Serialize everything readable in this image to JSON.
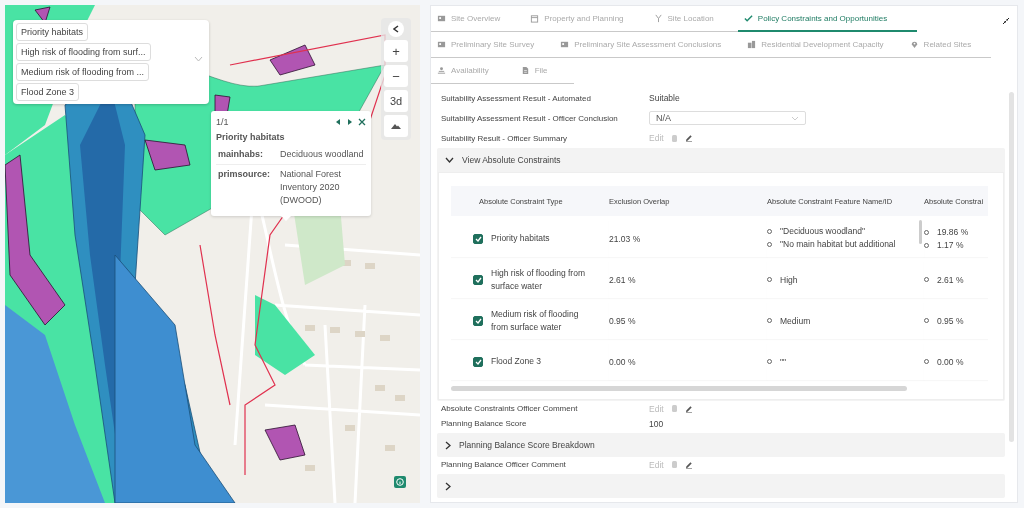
{
  "map": {
    "layers": [
      {
        "label": "Priority habitats"
      },
      {
        "label": "High risk of flooding from surf..."
      },
      {
        "label": "Medium risk of flooding from ..."
      },
      {
        "label": "Flood Zone 3"
      }
    ],
    "controls": [
      {
        "kind": "collapse"
      },
      {
        "kind": "zoom_in",
        "label": "+"
      },
      {
        "kind": "zoom_out",
        "label": "−"
      },
      {
        "kind": "text",
        "label": "3d"
      },
      {
        "kind": "terrain"
      }
    ],
    "popup": {
      "counter": "1/1",
      "title": "Priority habitats",
      "fields": [
        {
          "key": "mainhabs:",
          "value": "Deciduous woodland"
        },
        {
          "key": "primsource:",
          "value": "National Forest Inventory 2020 (DWOOD)"
        }
      ]
    }
  },
  "tab_rows": [
    [
      {
        "label": "Site Overview",
        "selected": false
      },
      {
        "label": "Property and Planning",
        "selected": false
      },
      {
        "label": "Site Location",
        "selected": false
      },
      {
        "label": "Policy Constraints and Opportunities",
        "selected": true
      }
    ],
    [
      {
        "label": "Preliminary Site Survey",
        "selected": false
      },
      {
        "label": "Preliminary Site Assessment Conclusions",
        "selected": false
      },
      {
        "label": "Residential Development Capacity",
        "selected": false
      },
      {
        "label": "Related Sites",
        "selected": false
      }
    ],
    [
      {
        "label": "Availability",
        "selected": false
      },
      {
        "label": "File",
        "selected": false
      }
    ]
  ],
  "content": [
    {
      "kind": "text_field",
      "label": "Suitability Assessment Result - Automated",
      "value": "Suitable"
    },
    {
      "kind": "select_field",
      "label": "Suitability Assessment Result - Officer Conclusion",
      "value": "N/A"
    },
    {
      "kind": "edit_field",
      "label": "Suitability Result - Officer Summary",
      "value": "Edit"
    },
    {
      "kind": "section",
      "title": "View Absolute Constraints",
      "expanded": true,
      "table": {
        "columns": [
          "Absolute Constraint Type",
          "Exclusion Overlap",
          "Absolute Constraint Feature Name/ID",
          "Absolute Constrai"
        ],
        "rows": [
          {
            "type": "Priority habitats",
            "checked": true,
            "overlap": "21.03 %",
            "features": [
              "\"Deciduous woodland\"",
              "\"No main habitat but additional"
            ],
            "values": [
              "19.86 %",
              "1.17 %"
            ]
          },
          {
            "type": "High risk of flooding from surface water",
            "checked": true,
            "overlap": "2.61 %",
            "features": [
              "High"
            ],
            "values": [
              "2.61 %"
            ]
          },
          {
            "type": "Medium risk of flooding from surface water",
            "checked": true,
            "overlap": "0.95 %",
            "features": [
              "Medium"
            ],
            "values": [
              "0.95 %"
            ]
          },
          {
            "type": "Flood Zone 3",
            "checked": true,
            "overlap": "0.00 %",
            "features": [
              "\"\""
            ],
            "values": [
              "0.00 %"
            ]
          }
        ]
      }
    },
    {
      "kind": "edit_field",
      "label": "Absolute Constraints Officer Comment",
      "value": "Edit"
    },
    {
      "kind": "text_field",
      "label": "Planning Balance Score",
      "value": "100"
    },
    {
      "kind": "section",
      "title": "Planning Balance Score Breakdown",
      "expanded": false
    },
    {
      "kind": "edit_field",
      "label": "Planning Balance Officer Comment",
      "value": "Edit"
    },
    {
      "kind": "section",
      "expanded": false
    }
  ]
}
